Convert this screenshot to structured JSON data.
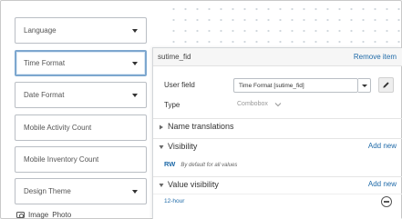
{
  "form_fields": [
    {
      "label": "Language",
      "has_dropdown": true
    },
    {
      "label": "Time Format",
      "has_dropdown": true,
      "selected": true
    },
    {
      "label": "Date Format",
      "has_dropdown": true
    },
    {
      "label": "Mobile Activity Count",
      "has_dropdown": false
    },
    {
      "label": "Mobile Inventory Count",
      "has_dropdown": false
    },
    {
      "label": "Design Theme",
      "has_dropdown": true
    }
  ],
  "bottom_options": {
    "image_label": "Image",
    "photo_label": "Photo"
  },
  "panel": {
    "field_id": "sutime_fid",
    "remove_label": "Remove item",
    "user_field_label": "User field",
    "user_field_value": "Time Format [sutime_fid]",
    "type_label": "Type",
    "type_value": "Combobox",
    "name_translations_label": "Name translations",
    "visibility": {
      "label": "Visibility",
      "add_label": "Add new",
      "permission": "RW",
      "permission_desc": "By default for all values"
    },
    "value_visibility": {
      "label": "Value visibility",
      "add_label": "Add new",
      "values": [
        "12-hour"
      ]
    }
  },
  "colors": {
    "link": "#1f6aa8",
    "selected_border": "#7da7cf"
  },
  "icons": [
    "chevron-down-icon",
    "pencil-icon",
    "triangle-right-icon",
    "triangle-down-icon",
    "minus-circle-icon",
    "camera-icon"
  ]
}
